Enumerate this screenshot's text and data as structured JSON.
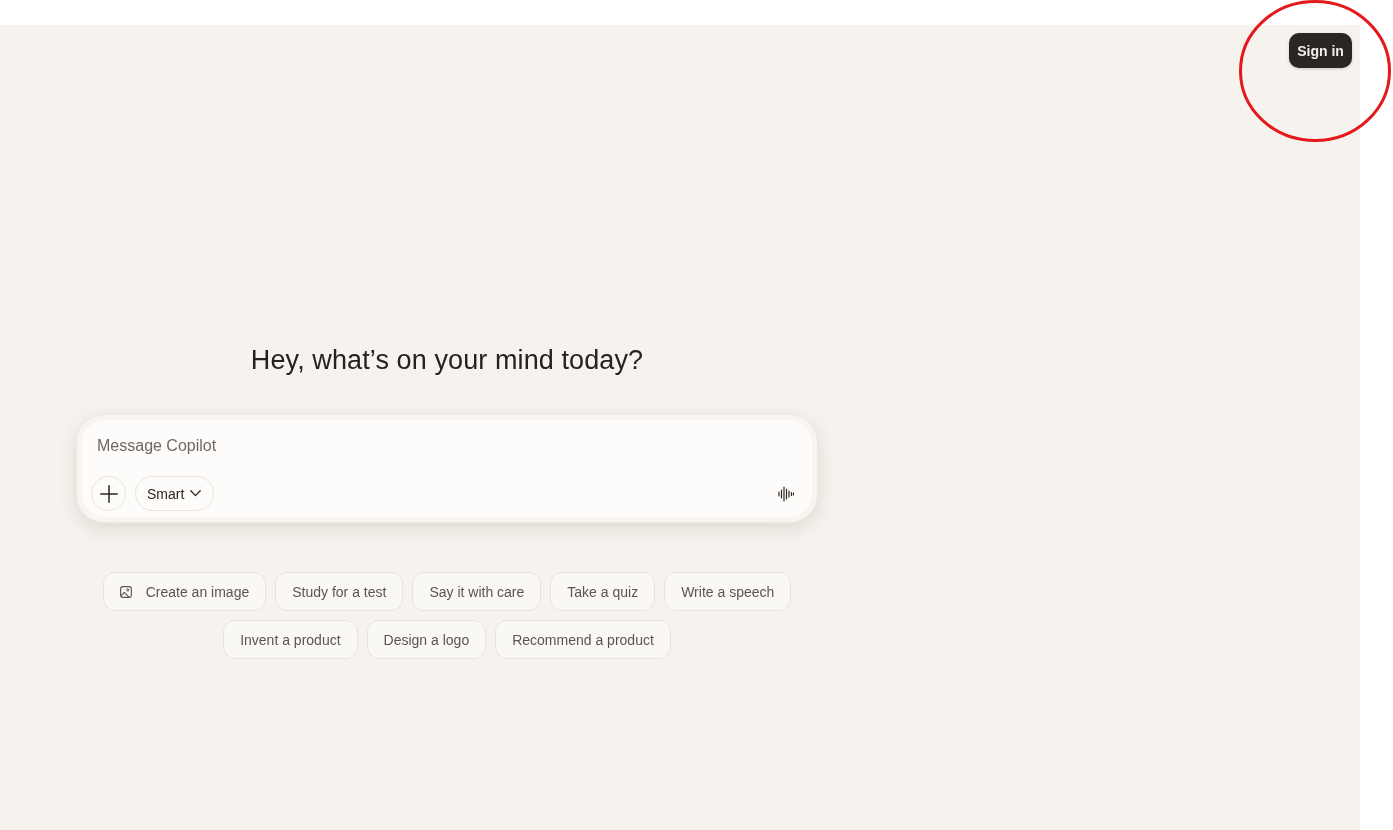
{
  "header": {
    "sign_in": "Sign in"
  },
  "heading": "Hey, what’s on your mind today?",
  "composer": {
    "placeholder": "Message Copilot",
    "mode": "Smart"
  },
  "suggestion_rows": [
    {
      "chips": [
        {
          "label": "Create an image",
          "kind": "image"
        },
        {
          "label": "Study for a test",
          "kind": "plain"
        },
        {
          "label": "Say it with care",
          "kind": "plain"
        },
        {
          "label": "Take a quiz",
          "kind": "plain"
        },
        {
          "label": "Write a speech",
          "kind": "plain"
        }
      ]
    },
    {
      "chips": [
        {
          "label": "Invent a product",
          "kind": "plain"
        },
        {
          "label": "Design a logo",
          "kind": "plain"
        },
        {
          "label": "Recommend a product",
          "kind": "plain"
        }
      ]
    }
  ],
  "annotations": [
    {
      "kind": "ellipse"
    }
  ]
}
